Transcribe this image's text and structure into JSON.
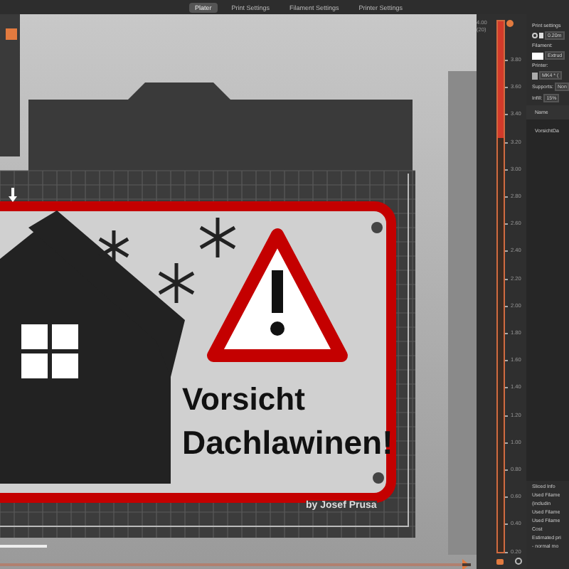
{
  "tabs": [
    {
      "label": "Plater",
      "selected": true
    },
    {
      "label": "Print Settings",
      "selected": false
    },
    {
      "label": "Filament Settings",
      "selected": false
    },
    {
      "label": "Printer Settings",
      "selected": false
    }
  ],
  "model": {
    "lines": [
      "Vorsicht",
      "Dachlawinen!"
    ],
    "credit": "by Josef Prusa"
  },
  "layer_slider": {
    "top_value": "4.00",
    "top_layer": "(20)",
    "level": 1,
    "ticks": [
      "3.80",
      "3.60",
      "3.40",
      "3.20",
      "3.00",
      "2.80",
      "2.60",
      "2.40",
      "2.20",
      "2.00",
      "1.80",
      "1.60",
      "1.40",
      "1.20",
      "1.00",
      "0.80",
      "0.60",
      "0.40",
      "0.20"
    ]
  },
  "horizontal_slider": {
    "level": 1
  },
  "sidebar": {
    "print_settings": {
      "label": "Print settings",
      "value": "0.20m"
    },
    "filament": {
      "label": "Filament:",
      "value": "Extrud"
    },
    "printer": {
      "label": "Printer:",
      "value": "MK4 * ("
    },
    "supports": {
      "label": "Supports:",
      "value": "Non"
    },
    "infill": {
      "label": "Infill:",
      "value": "15%"
    },
    "objects": {
      "column": "Name",
      "rows": [
        "VorsichtDa"
      ]
    },
    "sliced_info": {
      "title": "Sliced Info",
      "lines": [
        "Used Filame",
        "(includin",
        "Used Filame",
        "Used Filame",
        "Cost",
        "Estimated pri",
        "- normal mo"
      ]
    }
  }
}
